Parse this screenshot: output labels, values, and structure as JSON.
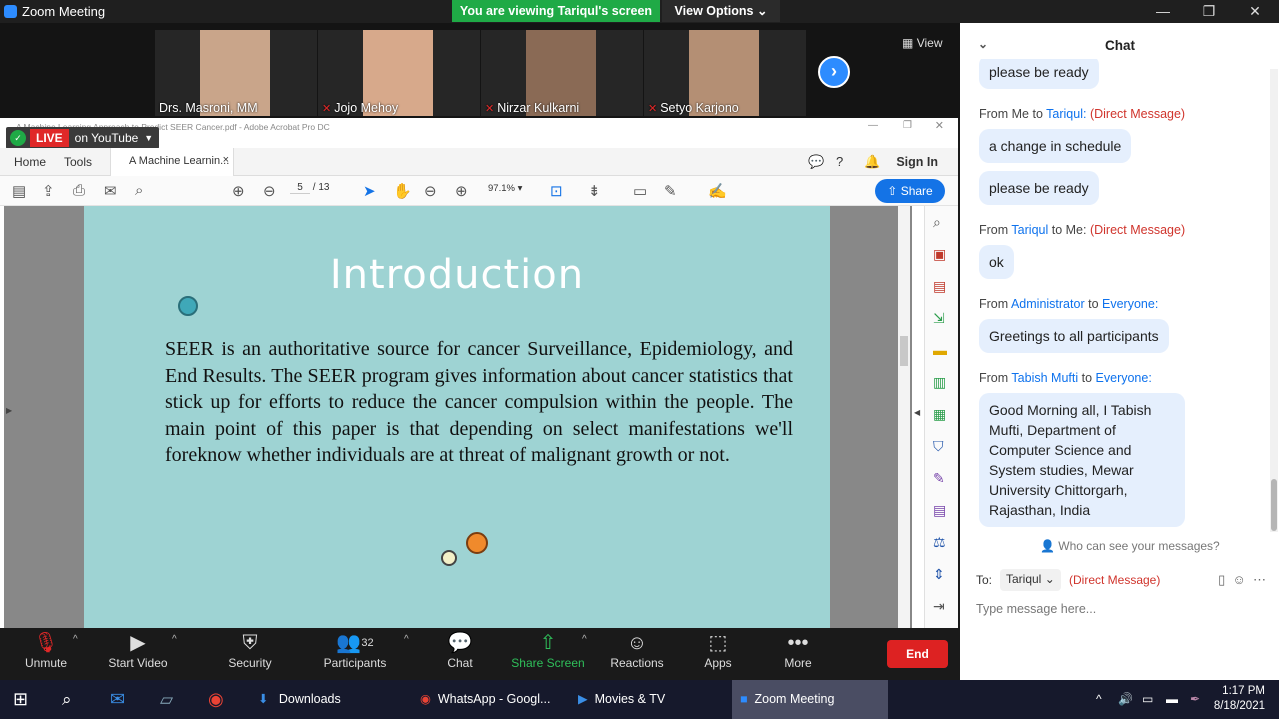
{
  "app": {
    "title": "Zoom Meeting",
    "banner": "You are viewing Tariqul's screen",
    "view_options": "View Options"
  },
  "participants": [
    {
      "name": "Drs. Masroni, MM",
      "muted": false,
      "face_color": "#c9a58a"
    },
    {
      "name": "Jojo Mehoy",
      "muted": true,
      "face_color": "#d7a98b"
    },
    {
      "name": "Nirzar Kulkarni",
      "muted": true,
      "face_color": "#8a6a55"
    },
    {
      "name": "Setyo Karjono",
      "muted": true,
      "face_color": "#b48f74"
    }
  ],
  "strip": {
    "view_label": "View",
    "hand_icon": "raised-hand-icon"
  },
  "acrobat": {
    "window_title": "A Machine Learning Approach to Predict SEER Cancer.pdf - Adobe Acrobat Pro DC",
    "live_badge": "LIVE",
    "live_text": "on YouTube",
    "tabs": {
      "home": "Home",
      "tools": "Tools",
      "doc": "A Machine Learnin...",
      "close": "×"
    },
    "sign_in": "Sign In",
    "page_current": "5",
    "page_total": "/ 13",
    "zoom": "97.1%",
    "share": "Share"
  },
  "slide": {
    "title": "Introduction",
    "body": "SEER is an authoritative source for cancer Surveillance, Epidemiology, and End Results. The SEER program gives information about cancer statistics that stick up for efforts to reduce the cancer compulsion within the people. The main point of this paper is that depending on select manifestations we'll foreknow whether individuals are at threat of malignant growth or not.",
    "colors": {
      "bg": "#9ed3d3",
      "dot1": "#3fa8b8",
      "dot2": "#f08a2c",
      "dot3": "#f3f0c8"
    }
  },
  "toolbar": {
    "unmute": "Unmute",
    "start_video": "Start Video",
    "security": "Security",
    "participants": "Participants",
    "participants_count": "32",
    "chat": "Chat",
    "share_screen": "Share Screen",
    "reactions": "Reactions",
    "apps": "Apps",
    "more": "More",
    "end": "End"
  },
  "chat": {
    "title": "Chat",
    "messages": [
      {
        "bubble": "please be ready"
      },
      {
        "from": "From Me to",
        "name": "Tariqul:",
        "to": "",
        "dm": "(Direct Message)",
        "bubble": "a change in schedule"
      },
      {
        "bubble": "please be ready"
      },
      {
        "from": "From",
        "name": "Tariqul",
        "to": "to Me:",
        "dm": "(Direct Message)",
        "bubble": "ok"
      },
      {
        "from": "From",
        "name": "Administrator",
        "to": "to",
        "to2": "Everyone:",
        "bubble": "Greetings to all participants"
      },
      {
        "from": "From",
        "name": "Tabish Mufti",
        "to": "to",
        "to2": "Everyone:",
        "bubble": "Good Morning all,  I Tabish Mufti, Department of Computer Science and System studies, Mewar University Chittorgarh, Rajasthan, India"
      }
    ],
    "who_can_see": "Who can see your messages?",
    "to_label": "To:",
    "to_value": "Tariqul",
    "to_dm": "(Direct Message)",
    "input_placeholder": "Type message here..."
  },
  "taskbar": {
    "items": [
      "Downloads",
      "WhatsApp - Googl...",
      "Movies & TV",
      "Zoom Meeting"
    ],
    "time": "1:17 PM",
    "date": "8/18/2021"
  }
}
